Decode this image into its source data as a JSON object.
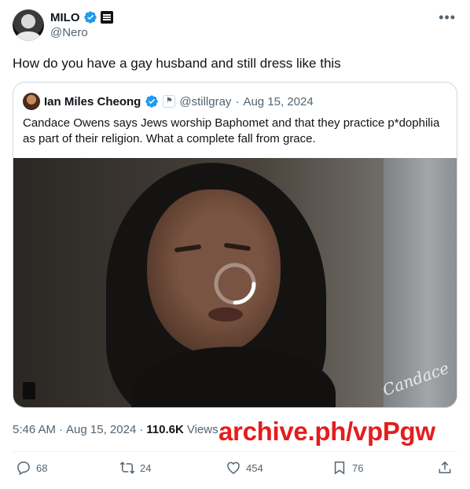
{
  "author": {
    "display_name": "MILO",
    "handle": "@Nero"
  },
  "tweet": {
    "text": "How do you have a gay husband and still dress like this",
    "time": "5:46 AM",
    "date": "Aug 15, 2024",
    "views": "110.6K",
    "views_label": "Views"
  },
  "quote": {
    "display_name": "Ian Miles Cheong",
    "handle": "@stillgray",
    "date": "Aug 15, 2024",
    "text": "Candace Owens says Jews worship Baphomet and that they practice p*dophilia as part of their religion. What a complete fall from grace.",
    "media_signature": "Candace"
  },
  "overlay": {
    "archive_text": "archive.ph/vpPgw",
    "color": "#e41d1d"
  },
  "actions": {
    "replies": "68",
    "reposts": "24",
    "likes": "454",
    "bookmarks": "76"
  },
  "icons": [
    "verified-icon",
    "more-icon",
    "reply-icon",
    "repost-icon",
    "like-icon",
    "bookmark-icon",
    "share-icon"
  ],
  "colors": {
    "verified": "#1d9bf0",
    "muted": "#536471",
    "text": "#0f1419"
  }
}
